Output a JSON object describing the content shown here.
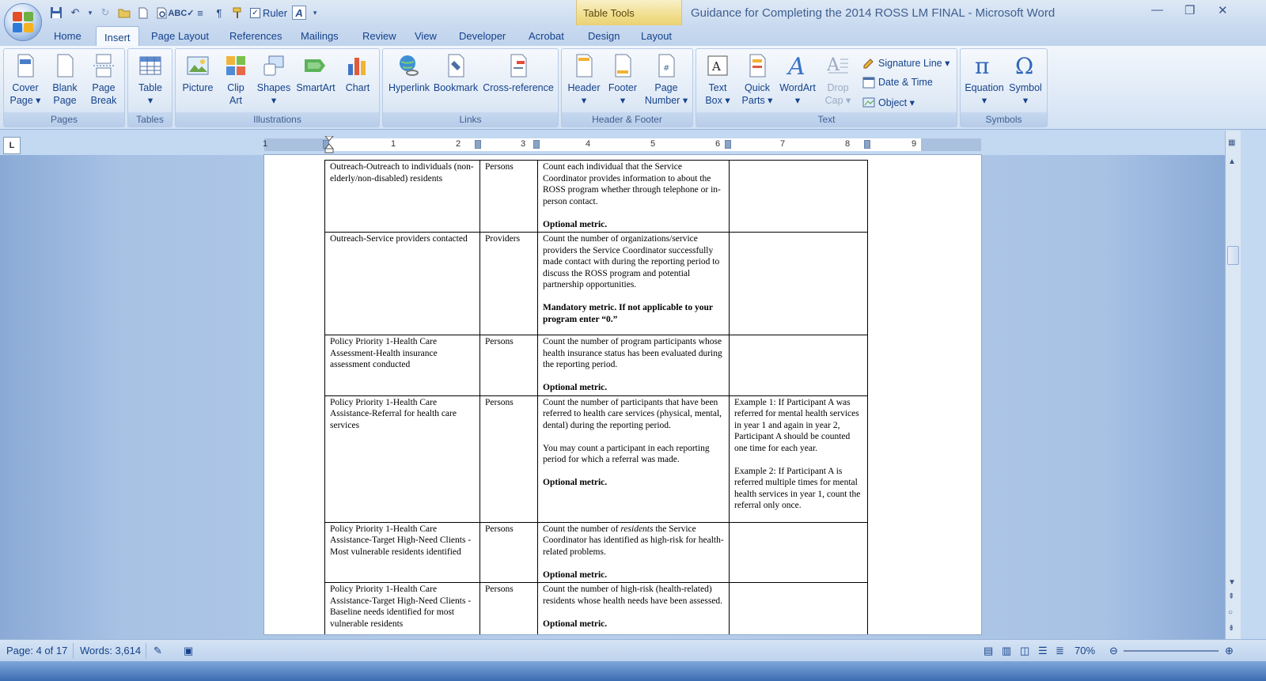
{
  "window": {
    "title": "Guidance for Completing the 2014 ROSS LM FINAL - Microsoft Word",
    "context_tab": "Table Tools"
  },
  "qat": {
    "ruler_label": "Ruler"
  },
  "tabs": [
    "Home",
    "Insert",
    "Page Layout",
    "References",
    "Mailings",
    "Review",
    "View",
    "Developer",
    "Acrobat",
    "Design",
    "Layout"
  ],
  "ribbon": {
    "groups": {
      "pages": "Pages",
      "tables": "Tables",
      "illustrations": "Illustrations",
      "links": "Links",
      "header_footer": "Header & Footer",
      "text": "Text",
      "symbols": "Symbols"
    },
    "buttons": {
      "cover_page": [
        "Cover",
        "Page ▾"
      ],
      "blank_page": [
        "Blank",
        "Page"
      ],
      "page_break": [
        "Page",
        "Break"
      ],
      "table": [
        "Table",
        "▾"
      ],
      "picture": [
        "Picture"
      ],
      "clip_art": [
        "Clip",
        "Art"
      ],
      "shapes": [
        "Shapes",
        "▾"
      ],
      "smartart": [
        "SmartArt"
      ],
      "chart": [
        "Chart"
      ],
      "hyperlink": [
        "Hyperlink"
      ],
      "bookmark": [
        "Bookmark"
      ],
      "cross_reference": [
        "Cross-reference"
      ],
      "header": [
        "Header",
        "▾"
      ],
      "footer": [
        "Footer",
        "▾"
      ],
      "page_number": [
        "Page",
        "Number ▾"
      ],
      "text_box": [
        "Text",
        "Box ▾"
      ],
      "quick_parts": [
        "Quick",
        "Parts ▾"
      ],
      "wordart": [
        "WordArt",
        "▾"
      ],
      "drop_cap": [
        "Drop",
        "Cap ▾"
      ],
      "equation": [
        "Equation",
        "▾"
      ],
      "symbol": [
        "Symbol",
        "▾"
      ]
    },
    "small": {
      "signature_line": "Signature Line ▾",
      "date_time": "Date & Time",
      "object": "Object ▾"
    }
  },
  "ruler": {
    "numbers": [
      "1",
      "1",
      "2",
      "3",
      "4",
      "5",
      "6",
      "7",
      "8",
      "9"
    ]
  },
  "rows": [
    {
      "c1": "Outreach-Outreach to individuals (non-elderly/non-disabled) residents",
      "c2": "Persons",
      "c3": [
        "Count each individual that the Service Coordinator provides information to about the ROSS program whether through telephone or in-person contact."
      ],
      "metric": "Optional metric.",
      "c4": []
    },
    {
      "c1": "Outreach-Service providers contacted",
      "c2": "Providers",
      "c3": [
        "Count the number of organizations/service providers the Service Coordinator successfully made contact with during the reporting period to discuss the ROSS program and potential partnership opportunities."
      ],
      "metric": "Mandatory metric. If not applicable to your program enter “0.”",
      "c4": []
    },
    {
      "c1": "Policy Priority 1-Health Care Assessment-Health insurance assessment conducted",
      "c2": "Persons",
      "c3": [
        "Count the number of program participants whose health insurance status has been evaluated during the reporting period."
      ],
      "metric": "Optional metric.",
      "c4": []
    },
    {
      "c1": "Policy Priority 1-Health Care Assistance-Referral for health care services",
      "c2": "Persons",
      "c3": [
        "Count the number of participants that have been referred to health care services (physical, mental, dental) during the reporting period.",
        "You may count a participant in each reporting period for which a referral was made."
      ],
      "metric": "Optional metric.",
      "c4": [
        "Example 1: If Participant A was referred for mental health services in year 1 and again in year 2, Participant A should be counted one time for each year.",
        "Example 2:  If Participant A is referred multiple times for mental health services in year 1, count the referral only once."
      ]
    },
    {
      "c1": "Policy Priority 1-Health Care Assistance-Target High-Need Clients -Most vulnerable residents identified",
      "c2": "Persons",
      "c3_pre": "Count the number of ",
      "c3_em": "residents",
      "c3_post": " the Service Coordinator has identified as high-risk for health-related problems.",
      "metric": "Optional metric.",
      "c4": []
    },
    {
      "c1": "Policy Priority 1-Health Care Assistance-Target High-Need Clients -Baseline needs identified for most vulnerable residents",
      "c2": "Persons",
      "c3": [
        "Count the number of high-risk (health-related) residents whose health needs have been assessed."
      ],
      "metric": "Optional metric.",
      "c4": []
    }
  ],
  "status": {
    "page": "Page: 4 of 17",
    "words": "Words: 3,614",
    "zoom": "70%"
  },
  "colors": {
    "accent": "#15428b",
    "ribbon_bg": "#dde8f5",
    "context_tab": "#f1dd8a"
  }
}
